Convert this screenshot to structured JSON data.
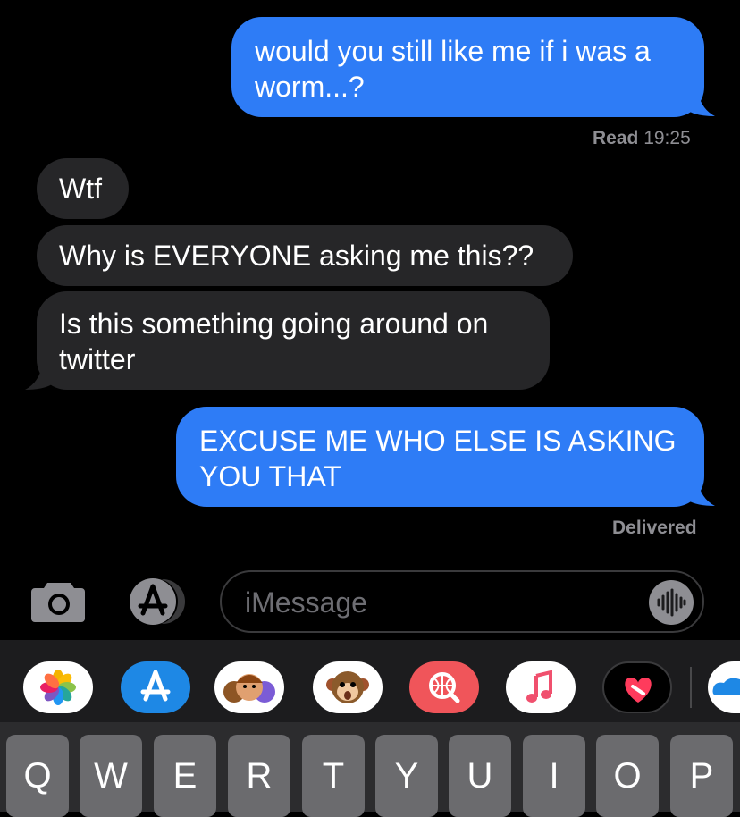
{
  "conversation": {
    "messages": [
      {
        "direction": "sent",
        "text": "would you still like me if i was a worm...?"
      },
      {
        "direction": "received",
        "text": "Wtf"
      },
      {
        "direction": "received",
        "text": "Why is EVERYONE asking me this??"
      },
      {
        "direction": "received",
        "text": "Is this something going around on twitter"
      },
      {
        "direction": "sent",
        "text": "EXCUSE ME WHO ELSE IS ASKING YOU THAT"
      }
    ],
    "read_receipt": {
      "label": "Read",
      "time": "19:25"
    },
    "delivered_label": "Delivered"
  },
  "input_bar": {
    "placeholder": "iMessage",
    "camera_icon": "camera-icon",
    "apps_icon": "app-store-icon",
    "audio_icon": "audio-waveform-icon"
  },
  "app_drawer": {
    "apps": [
      "photos-icon",
      "app-store-icon",
      "memoji-icon",
      "animoji-monkey-icon",
      "search-images-icon",
      "music-icon",
      "digital-touch-heart-icon",
      "cloud-app-icon"
    ]
  },
  "keyboard": {
    "row1": [
      "Q",
      "W",
      "E",
      "R",
      "T",
      "Y",
      "U",
      "I",
      "O",
      "P"
    ]
  },
  "colors": {
    "sent_bubble": "#2e7cf6",
    "received_bubble": "#262628",
    "background": "#000000"
  }
}
